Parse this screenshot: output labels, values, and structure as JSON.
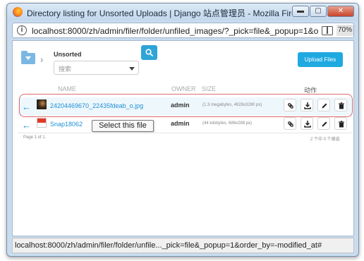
{
  "window": {
    "title": "Directory listing for Unsorted Uploads | Django 站点管理员 - Mozilla Firefox",
    "buttons": {
      "minimize": "▬",
      "maximize": "▢",
      "close": "✕"
    }
  },
  "urlbar": {
    "url": "localhost:8000/zh/admin/filer/folder/unfiled_images/?_pick=file&_popup=1&o",
    "zoom": "70%"
  },
  "toolbar": {
    "folder_name": "Unsorted",
    "search_placeholder": "搜索",
    "upload_label": "Upload Files"
  },
  "table": {
    "headers": {
      "name": "NAME",
      "owner": "OWNER",
      "size": "SIZE",
      "actions": "动作"
    },
    "rows": [
      {
        "filename": "24204469670_22435fdeab_o.jpg",
        "owner": "admin",
        "size": "(1.3 megabytes, 4928x3280 px)",
        "thumb": "dark"
      },
      {
        "filename": "Snap18062",
        "owner": "admin",
        "size": "(44 kilobytes, 686x288 px)",
        "thumb": "red"
      }
    ],
    "actions": [
      "link-icon",
      "download-icon",
      "edit-icon",
      "trash-icon"
    ],
    "tooltip": "Select this file",
    "footer_left": "Page 1 of 1.",
    "footer_right": "2 个中 0 个被选"
  },
  "statusbar": {
    "text": "localhost:8000/zh/admin/filer/folder/unfile..._pick=file&_popup=1&order_by=-modified_at#"
  },
  "colors": {
    "accent": "#1fa9e1",
    "link": "#1e90d6",
    "highlight": "#e06a6a"
  }
}
